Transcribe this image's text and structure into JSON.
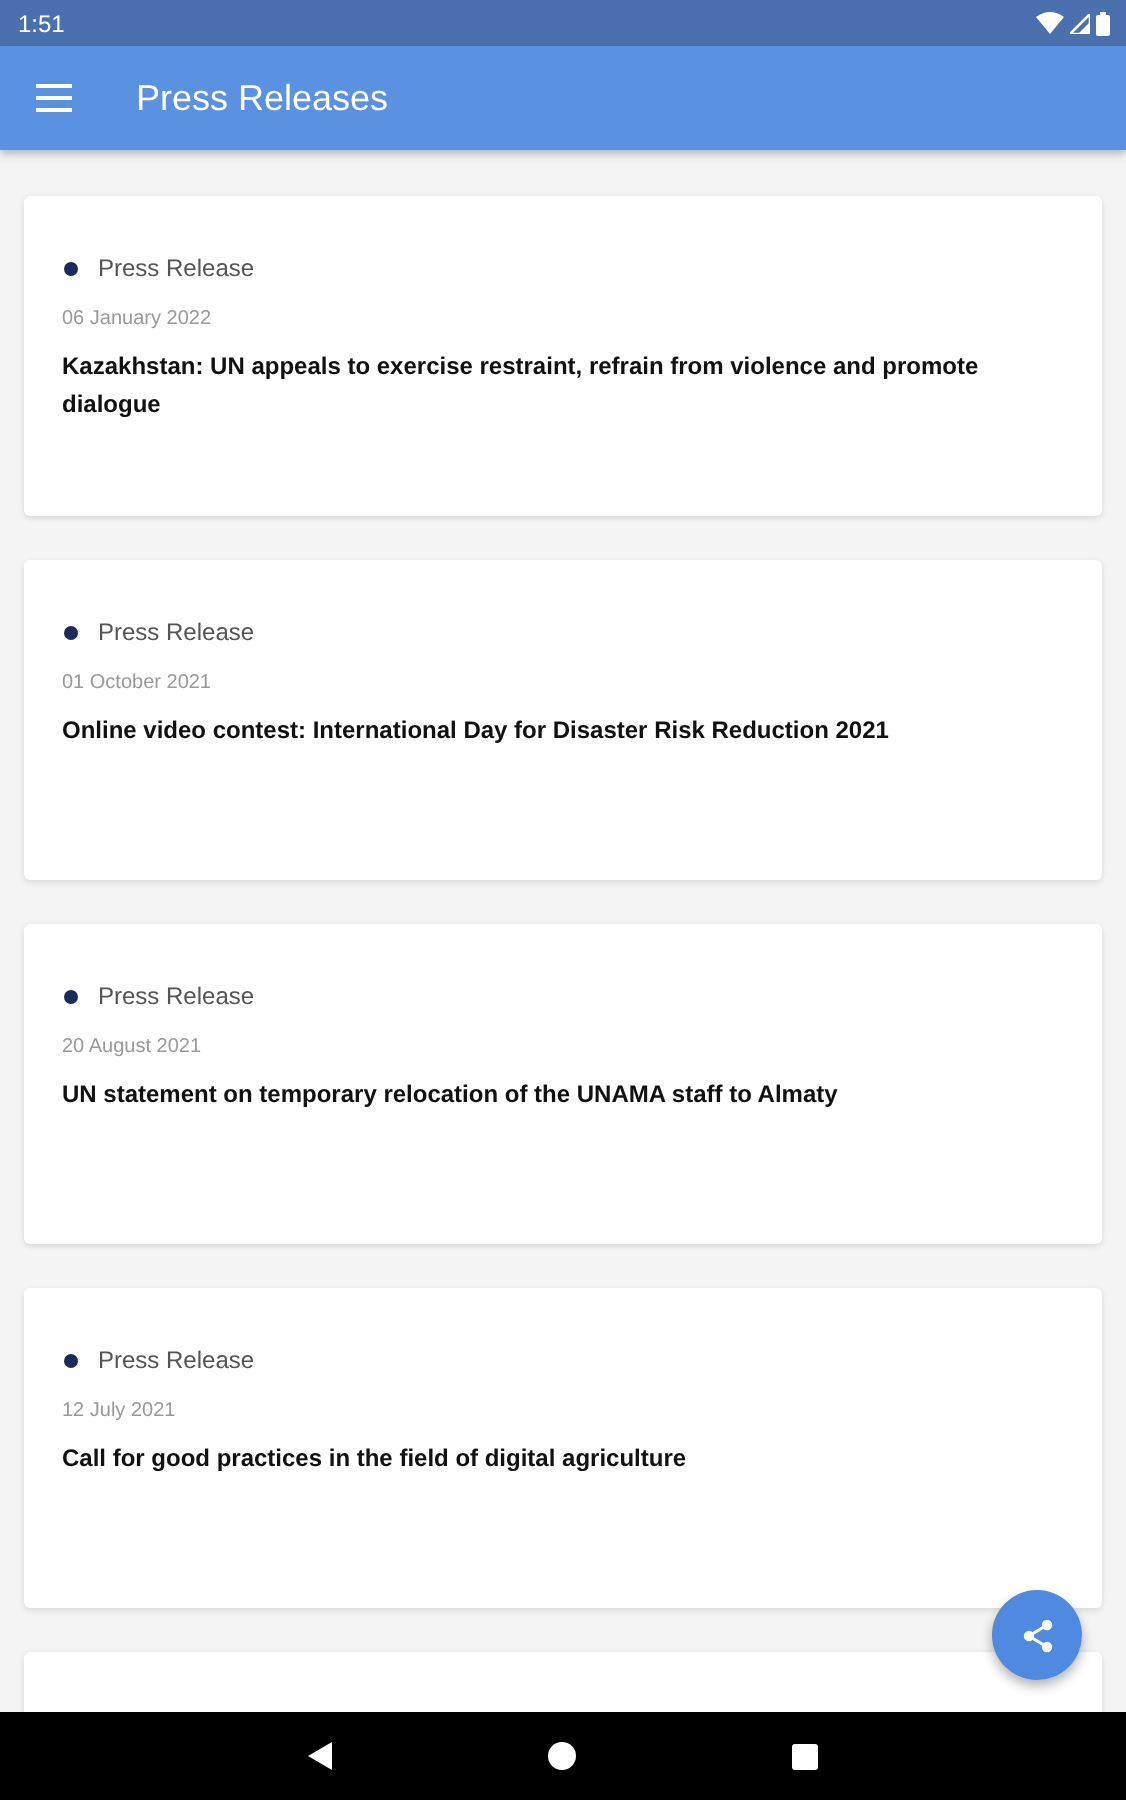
{
  "status_bar": {
    "time": "1:51"
  },
  "app_bar": {
    "title": "Press Releases"
  },
  "cards": [
    {
      "kind": "release",
      "category": "Press Release",
      "color": "#1a2a5c",
      "date": "06 January 2022",
      "title": "Kazakhstan: UN appeals to exercise restraint, refrain from violence and promote dialogue"
    },
    {
      "kind": "release",
      "category": "Press Release",
      "color": "#1a2a5c",
      "date": "01 October 2021",
      "title": "Online video contest: International Day for Disaster Risk Reduction 2021"
    },
    {
      "kind": "release",
      "category": "Press Release",
      "color": "#1a2a5c",
      "date": "20 August 2021",
      "title": "UN statement on temporary relocation of the UNAMA staff to Almaty"
    },
    {
      "kind": "release",
      "category": "Press Release",
      "color": "#1a2a5c",
      "date": "12 July 2021",
      "title": "Call for good practices in the field of digital agriculture"
    },
    {
      "kind": "partial"
    }
  ]
}
